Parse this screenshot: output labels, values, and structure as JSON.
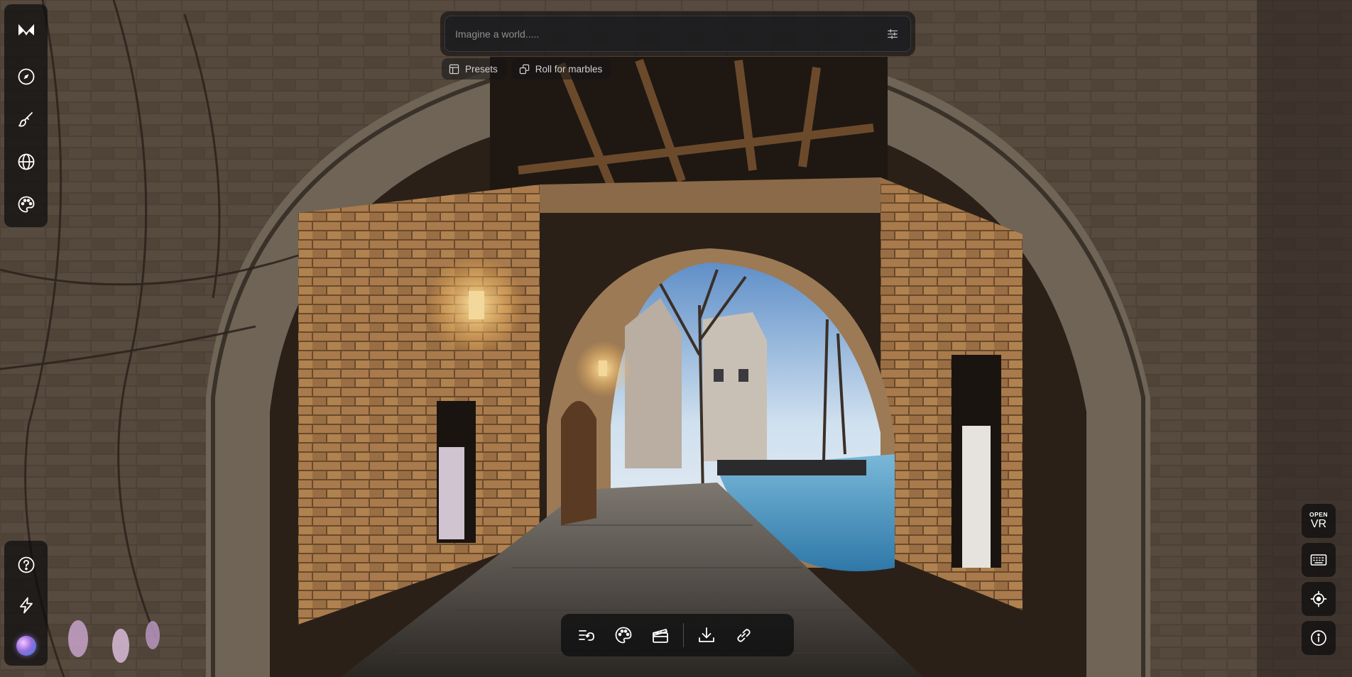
{
  "prompt": {
    "placeholder": "Imagine a world.....",
    "value": ""
  },
  "chips": [
    {
      "label": "Presets",
      "icon": "layout-icon"
    },
    {
      "label": "Roll for marbles",
      "icon": "dice-icon"
    }
  ],
  "left_rail": {
    "top": [
      {
        "name": "logo",
        "icon": "logo-icon"
      },
      {
        "name": "explore",
        "icon": "compass-icon"
      },
      {
        "name": "create",
        "icon": "brush-icon"
      },
      {
        "name": "worlds",
        "icon": "globe-icon"
      },
      {
        "name": "styles",
        "icon": "palette-icon"
      }
    ],
    "bottom": [
      {
        "name": "help",
        "icon": "help-icon"
      },
      {
        "name": "upgrade",
        "icon": "lightning-icon"
      },
      {
        "name": "account",
        "icon": "avatar-orb"
      }
    ]
  },
  "toolbar": {
    "buttons": [
      {
        "name": "history",
        "icon": "history-list-icon"
      },
      {
        "name": "style",
        "icon": "palette-icon"
      },
      {
        "name": "record",
        "icon": "clapperboard-icon"
      },
      {
        "name": "download",
        "icon": "download-icon"
      },
      {
        "name": "share-link",
        "icon": "link-icon"
      }
    ]
  },
  "right_controls": {
    "vr_small": "OPEN",
    "vr_big": "VR",
    "buttons": [
      {
        "name": "keyboard",
        "icon": "keyboard-icon"
      },
      {
        "name": "recenter",
        "icon": "crosshair-icon"
      },
      {
        "name": "info",
        "icon": "info-icon"
      }
    ]
  },
  "colors": {
    "panel": "#0c0c0e",
    "icon": "#ffffff",
    "placeholder": "#8f8f8f"
  }
}
